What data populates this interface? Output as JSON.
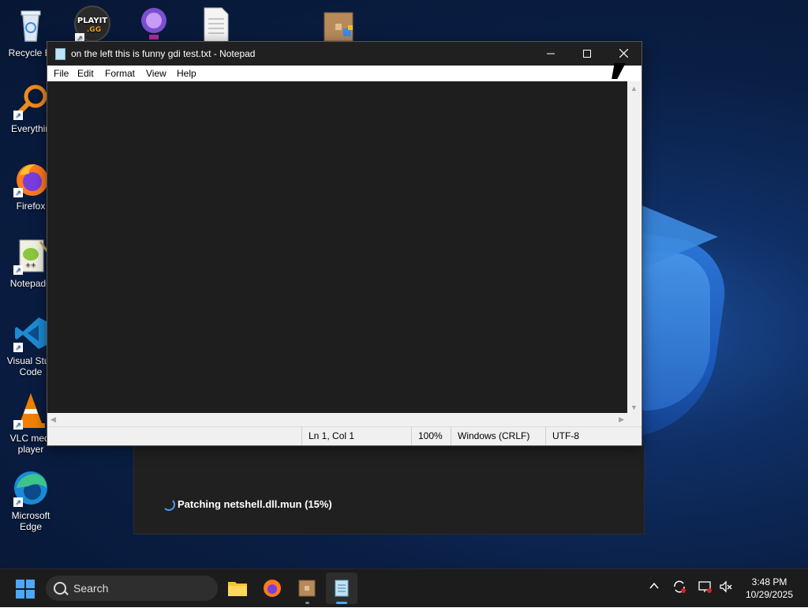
{
  "desktop": {
    "icons": [
      {
        "label": "Recycle Bi",
        "icon": "recycle-bin-icon"
      },
      {
        "label": "",
        "icon": "playit-gg-icon"
      },
      {
        "label": "",
        "icon": "globe-app-icon"
      },
      {
        "label": "",
        "icon": "text-document-icon"
      },
      {
        "label": "",
        "icon": "package-icon"
      },
      {
        "label": "Everythin",
        "icon": "everything-search-icon"
      },
      {
        "label": "Firefox",
        "icon": "firefox-icon"
      },
      {
        "label": "Notepad+",
        "icon": "notepad-plus-plus-icon"
      },
      {
        "label": "Visual Stud Code",
        "icon": "vscode-icon"
      },
      {
        "label": "VLC medi player",
        "icon": "vlc-icon"
      },
      {
        "label": "Microsoft Edge",
        "icon": "edge-icon"
      }
    ]
  },
  "progress_dialog": {
    "text": "Patching netshell.dll.mun (15%)",
    "progress": 0.15
  },
  "notepad": {
    "title": "on the left this is funny gdi test.txt - Notepad",
    "menu": [
      "File",
      "Edit",
      "Format",
      "View",
      "Help"
    ],
    "status": {
      "position": "Ln 1, Col 1",
      "zoom": "100%",
      "line_ending": "Windows (CRLF)",
      "encoding": "UTF-8"
    }
  },
  "taskbar": {
    "search_placeholder": "Search",
    "time": "3:48 PM",
    "date": "10/29/2025"
  },
  "colors": {
    "accent": "#4aa8ff",
    "editor_bg": "#1e1e1e",
    "taskbar_bg": "#1c1c1c"
  }
}
